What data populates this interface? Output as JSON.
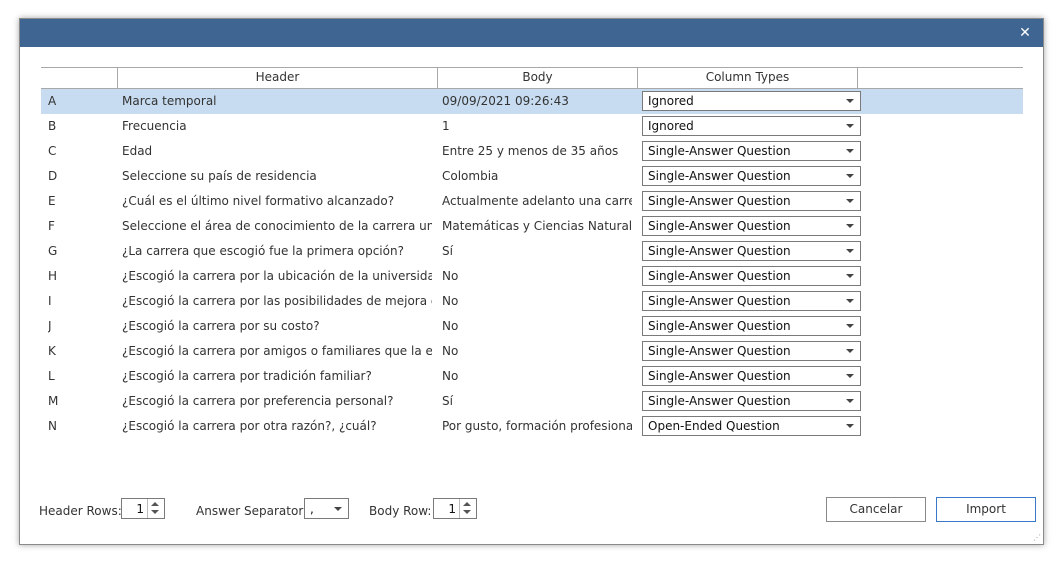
{
  "window": {
    "close_glyph": "✕"
  },
  "columns": {
    "header": "Header",
    "body": "Body",
    "types": "Column Types"
  },
  "rows": [
    {
      "letter": "A",
      "header": "Marca temporal",
      "body": "09/09/2021 09:26:43",
      "type": "Ignored"
    },
    {
      "letter": "B",
      "header": "Frecuencia",
      "body": "1",
      "type": "Ignored"
    },
    {
      "letter": "C",
      "header": "Edad",
      "body": "Entre 25 y menos de 35 años",
      "type": "Single-Answer Question"
    },
    {
      "letter": "D",
      "header": "Seleccione su país de residencia",
      "body": "Colombia",
      "type": "Single-Answer Question"
    },
    {
      "letter": "E",
      "header": "¿Cuál es el último nivel formativo alcanzado?",
      "body": "Actualmente adelanto una carrera p",
      "type": "Single-Answer Question"
    },
    {
      "letter": "F",
      "header": "Seleccione el área de conocimiento de la carrera universita",
      "body": "Matemáticas y Ciencias Naturales",
      "type": "Single-Answer Question"
    },
    {
      "letter": "G",
      "header": "¿La carrera que escogió fue la primera opción?",
      "body": "Sí",
      "type": "Single-Answer Question"
    },
    {
      "letter": "H",
      "header": "¿Escogió la carrera por la ubicación de la universidad?",
      "body": "No",
      "type": "Single-Answer Question"
    },
    {
      "letter": "I",
      "header": "¿Escogió la carrera por las posibilidades de mejora de la po",
      "body": "No",
      "type": "Single-Answer Question"
    },
    {
      "letter": "J",
      "header": "¿Escogió la carrera por su costo?",
      "body": "No",
      "type": "Single-Answer Question"
    },
    {
      "letter": "K",
      "header": "¿Escogió la carrera por amigos o familiares que la estudiab",
      "body": "No",
      "type": "Single-Answer Question"
    },
    {
      "letter": "L",
      "header": "¿Escogió la carrera por tradición familiar?",
      "body": "No",
      "type": "Single-Answer Question"
    },
    {
      "letter": "M",
      "header": "¿Escogió la carrera por preferencia personal?",
      "body": "Sí",
      "type": "Single-Answer Question"
    },
    {
      "letter": "N",
      "header": "¿Escogió la carrera por otra razón?, ¿cuál?",
      "body": "Por gusto, formación profesional y c",
      "type": "Open-Ended Question"
    }
  ],
  "selected_row": "A",
  "footer": {
    "header_rows_label": "Header Rows:",
    "header_rows_value": "1",
    "separator_label": "Answer Separator:",
    "separator_value": ",",
    "body_row_label": "Body Row:",
    "body_row_value": "1",
    "cancel_label": "Cancelar",
    "import_label": "Import"
  },
  "colors": {
    "titlebar": "#3f6592",
    "selected_row": "#c7dcf0",
    "primary_border": "#3a78c8"
  }
}
